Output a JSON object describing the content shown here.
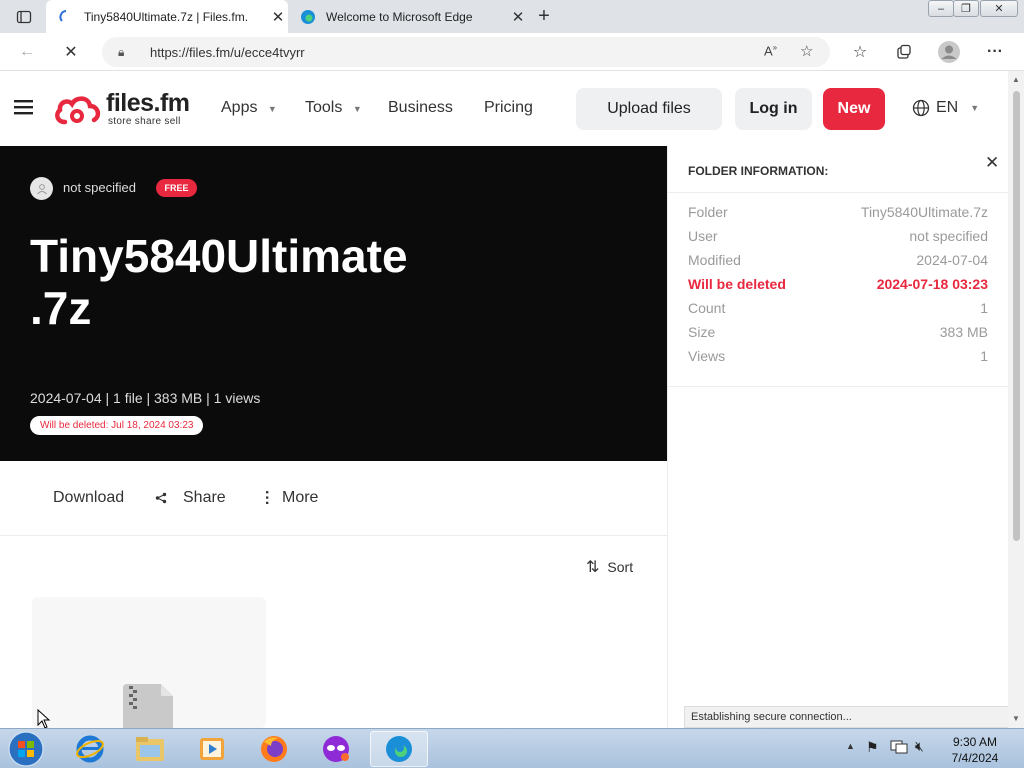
{
  "browser": {
    "tabs": [
      {
        "title": "Tiny5840Ultimate.7z | Files.fm.",
        "active": true
      },
      {
        "title": "Welcome to Microsoft Edge",
        "active": false
      }
    ],
    "url": "https://files.fm/u/ecce4tvyrr"
  },
  "header": {
    "logo_name": "files.fm",
    "logo_tagline": "store share sell",
    "nav": [
      "Apps",
      "Tools",
      "Business",
      "Pricing"
    ],
    "upload_label": "Upload files",
    "login_label": "Log in",
    "new_label": "New",
    "language": "EN"
  },
  "hero": {
    "user": "not specified",
    "badge": "FREE",
    "title_line1": "Tiny5840Ultimate",
    "title_line2": ".7z",
    "meta": "2024-07-04 | 1 file | 383 MB | 1 views",
    "delete_notice": "Will be deleted: Jul 18, 2024 03:23"
  },
  "actions": {
    "download": "Download",
    "share": "Share",
    "more": "More",
    "sort": "Sort"
  },
  "panel": {
    "heading": "FOLDER INFORMATION:",
    "rows": [
      {
        "label": "Folder",
        "value": "Tiny5840Ultimate.7z"
      },
      {
        "label": "User",
        "value": "not specified"
      },
      {
        "label": "Modified",
        "value": "2024-07-04"
      },
      {
        "label": "Will be deleted",
        "value": "2024-07-18 03:23"
      },
      {
        "label": "Count",
        "value": "1"
      },
      {
        "label": "Size",
        "value": "383 MB"
      },
      {
        "label": "Views",
        "value": "1"
      }
    ]
  },
  "status": "Establishing secure connection...",
  "taskbar": {
    "time": "9:30 AM",
    "date": "7/4/2024"
  },
  "colors": {
    "accent": "#e8283e",
    "hero_bg": "#0b0b0b"
  }
}
